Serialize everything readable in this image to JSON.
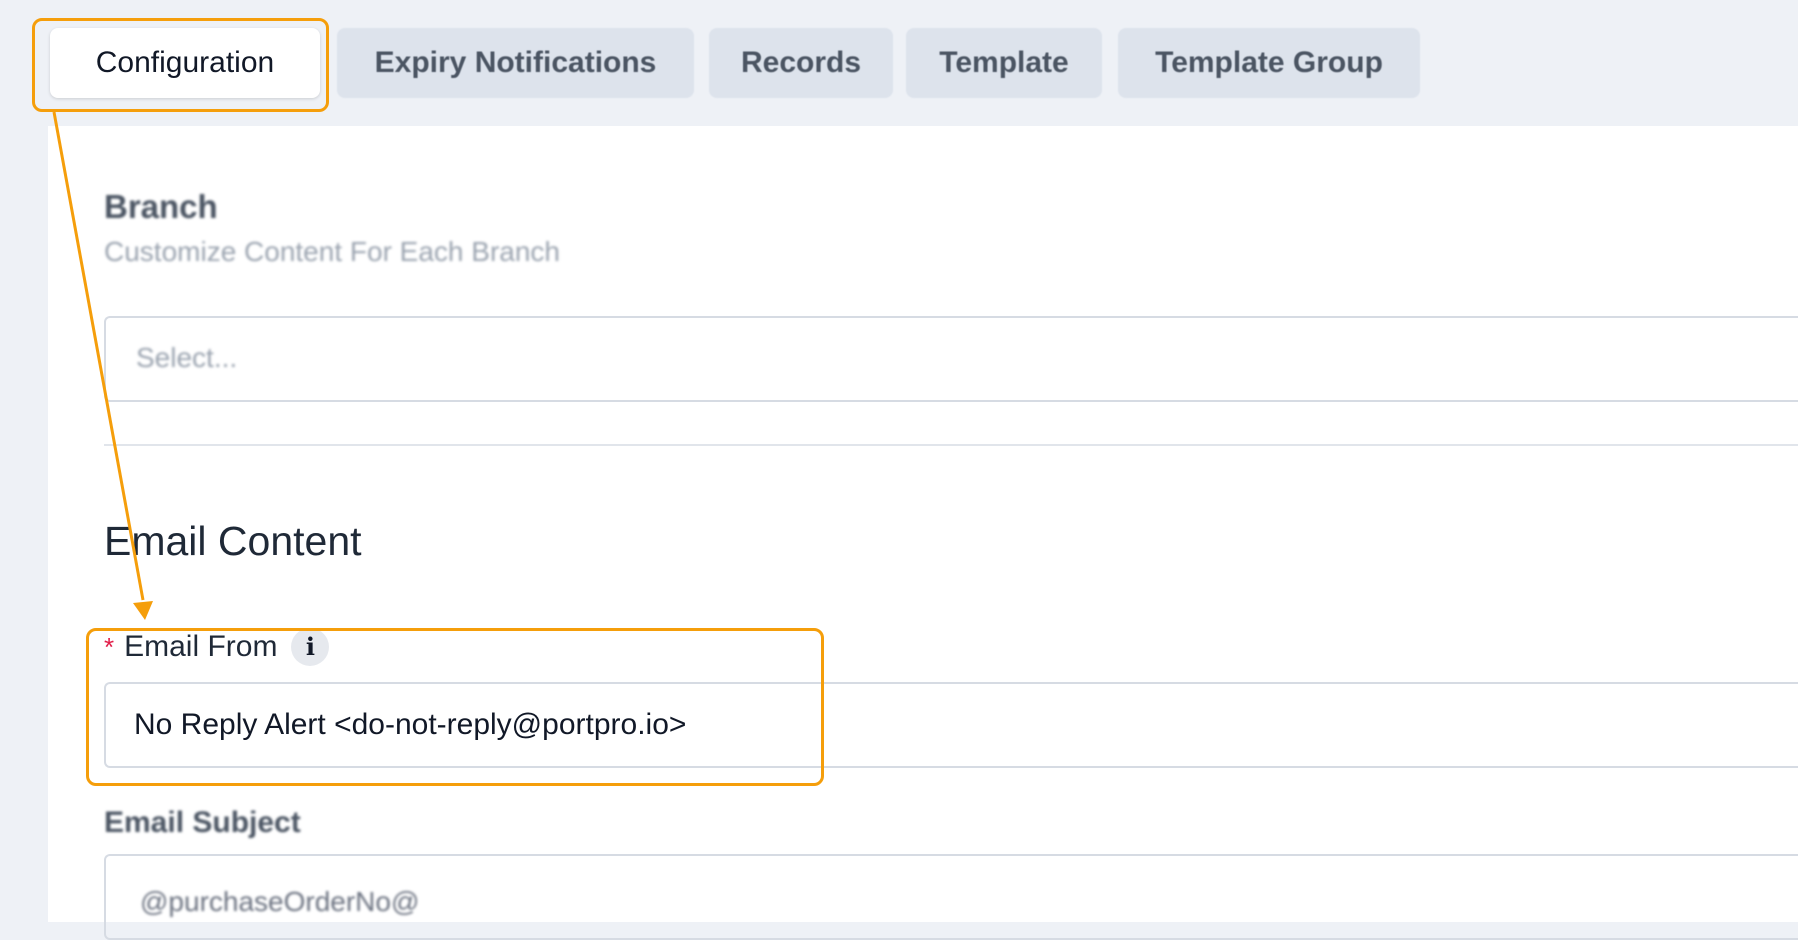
{
  "tabs": [
    {
      "label": "Configuration",
      "active": true
    },
    {
      "label": "Expiry Notifications",
      "active": false
    },
    {
      "label": "Records",
      "active": false
    },
    {
      "label": "Template",
      "active": false
    },
    {
      "label": "Template Group",
      "active": false
    }
  ],
  "branch": {
    "title": "Branch",
    "subtitle": "Customize Content For Each Branch",
    "placeholder": "Select..."
  },
  "email_content": {
    "title": "Email Content",
    "email_from": {
      "required_mark": "*",
      "label": "Email From",
      "info_icon": "i",
      "value": "No Reply Alert <do-not-reply@portpro.io>"
    },
    "email_subject": {
      "label": "Email Subject",
      "value": "@purchaseOrderNo@"
    }
  },
  "colors": {
    "highlight": "#f59e0b",
    "required": "#e11d48",
    "page_background": "#eef1f6"
  }
}
